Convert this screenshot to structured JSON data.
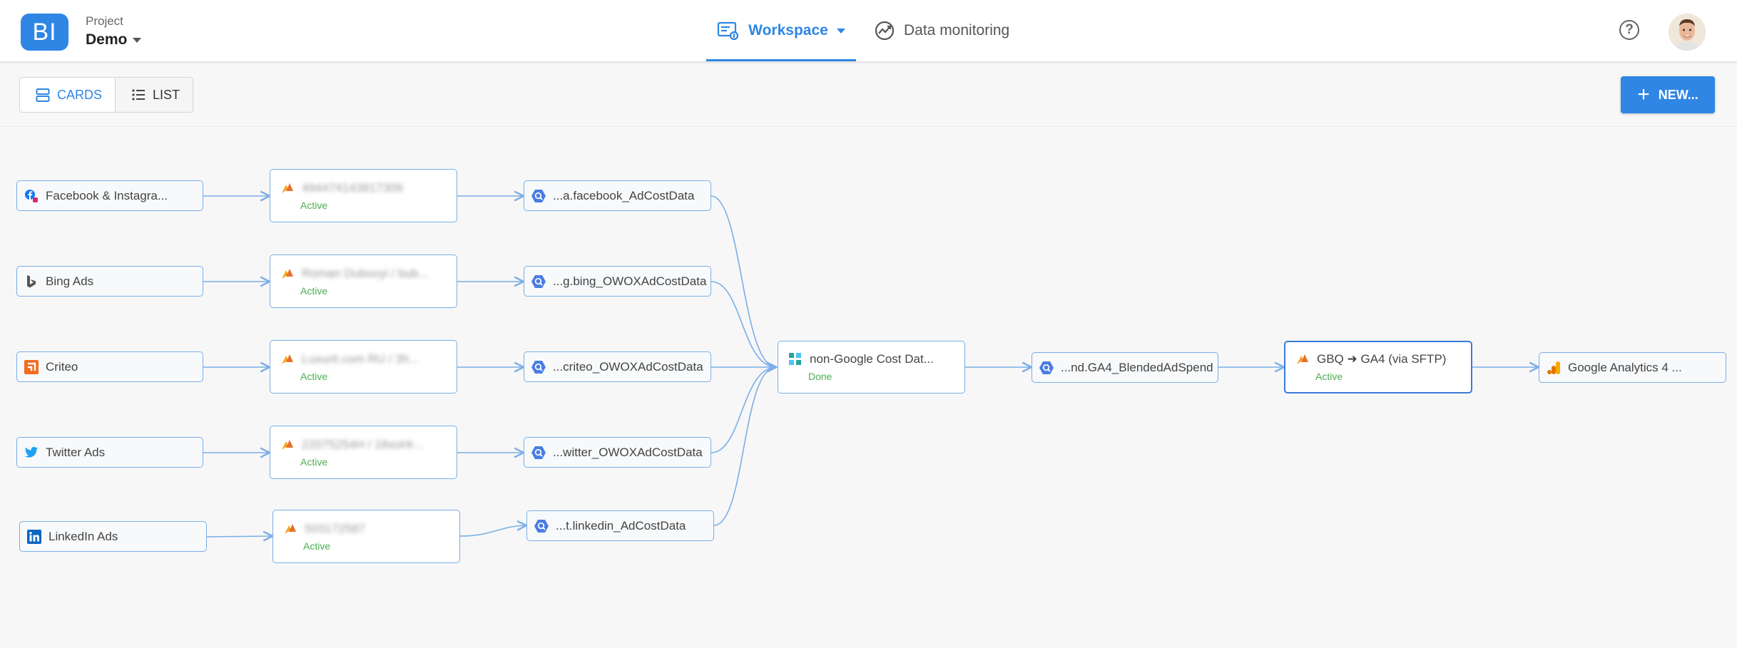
{
  "header": {
    "logo_text": "BI",
    "project_label": "Project",
    "project_name": "Demo",
    "tabs": [
      {
        "label": "Workspace",
        "active": true
      },
      {
        "label": "Data monitoring",
        "active": false
      }
    ],
    "help_icon": "question-circle-icon"
  },
  "toolbar": {
    "cards_label": "CARDS",
    "list_label": "LIST",
    "new_label": "NEW..."
  },
  "colors": {
    "accent": "#2f86e4",
    "node_border": "#7aaee6",
    "status_active": "#4caf50",
    "edge": "#7aaee6"
  },
  "pipeline": {
    "sources": [
      {
        "label": "Facebook & Instagra...",
        "icon": "facebook-icon"
      },
      {
        "label": "Bing Ads",
        "icon": "bing-icon"
      },
      {
        "label": "Criteo",
        "icon": "criteo-icon"
      },
      {
        "label": "Twitter Ads",
        "icon": "twitter-icon"
      },
      {
        "label": "LinkedIn Ads",
        "icon": "linkedin-icon"
      }
    ],
    "connectors": [
      {
        "label": "494474143817309",
        "status": "Active"
      },
      {
        "label": "Roman Dubovyi / bub...",
        "status": "Active"
      },
      {
        "label": "Luxurit.com RU / 3h...",
        "status": "Active"
      },
      {
        "label": "22075254H / 18xoHr...",
        "status": "Active"
      },
      {
        "label": "503172587",
        "status": "Active"
      }
    ],
    "tables": [
      {
        "label": "...a.facebook_AdCostData"
      },
      {
        "label": "...g.bing_OWOXAdCostData"
      },
      {
        "label": "...criteo_OWOXAdCostData"
      },
      {
        "label": "...witter_OWOXAdCostData"
      },
      {
        "label": "...t.linkedin_AdCostData"
      }
    ],
    "blend": {
      "label": "non-Google Cost Dat...",
      "status": "Done"
    },
    "blended_table": {
      "label": "...nd.GA4_BlendedAdSpend"
    },
    "export": {
      "label": "GBQ ➜ GA4 (via SFTP)",
      "status": "Active"
    },
    "destination": {
      "label": "Google Analytics 4 ..."
    }
  }
}
